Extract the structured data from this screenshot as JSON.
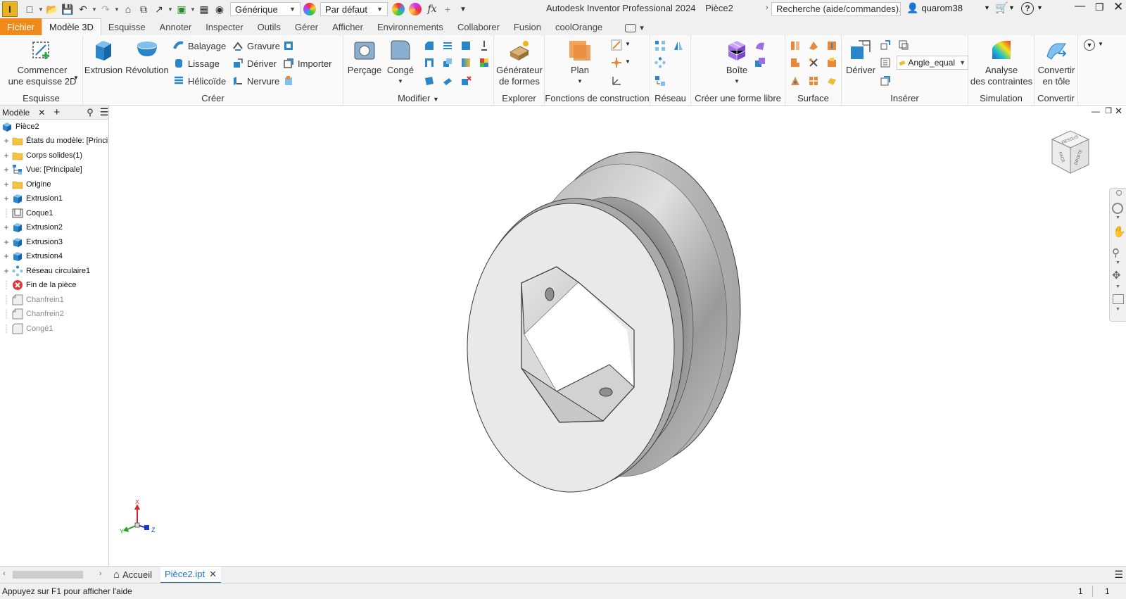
{
  "title_bar": {
    "material": "Générique",
    "appearance": "Par défaut",
    "app_title": "Autodesk Inventor Professional 2024",
    "document": "Pièce2",
    "search_placeholder": "Recherche (aide/commandes)...",
    "user": "quarom38"
  },
  "tabs": [
    {
      "label": "Fichier"
    },
    {
      "label": "Modèle 3D"
    },
    {
      "label": "Esquisse"
    },
    {
      "label": "Annoter"
    },
    {
      "label": "Inspecter"
    },
    {
      "label": "Outils"
    },
    {
      "label": "Gérer"
    },
    {
      "label": "Afficher"
    },
    {
      "label": "Environnements"
    },
    {
      "label": "Collaborer"
    },
    {
      "label": "Fusion"
    },
    {
      "label": "coolOrange"
    }
  ],
  "ribbon": {
    "esquisse": {
      "title": "Esquisse",
      "start_sketch_line1": "Commencer",
      "start_sketch_line2": "une esquisse 2D"
    },
    "creer": {
      "title": "Créer",
      "extrusion": "Extrusion",
      "revolution": "Révolution",
      "balayage": "Balayage",
      "lissage": "Lissage",
      "helicoide": "Hélicoïde",
      "gravure": "Gravure",
      "deriver": "Dériver",
      "nervure": "Nervure",
      "importer": "Importer"
    },
    "modifier": {
      "title": "Modifier",
      "percage": "Perçage",
      "conge": "Congé"
    },
    "explorer": {
      "title": "Explorer",
      "generator_line1": "Générateur",
      "generator_line2": "de formes"
    },
    "construction": {
      "title": "Fonctions de construction",
      "plan": "Plan"
    },
    "reseau": {
      "title": "Réseau"
    },
    "forme_libre": {
      "title": "Créer une forme libre",
      "boite": "Boîte"
    },
    "surface": {
      "title": "Surface"
    },
    "inserer": {
      "title": "Insérer",
      "deriver": "Dériver",
      "param": "Angle_equal"
    },
    "simulation": {
      "title": "Simulation",
      "analyse_line1": "Analyse",
      "analyse_line2": "des contraintes"
    },
    "convertir": {
      "title": "Convertir",
      "tole_line1": "Convertir",
      "tole_line2": "en tôle"
    }
  },
  "browser": {
    "tab": "Modèle",
    "root": "Pièce2",
    "items": [
      {
        "label": "États du modèle: [Princi",
        "icon": "folder-icon",
        "expandable": true,
        "dim": false
      },
      {
        "label": "Corps solides(1)",
        "icon": "folder-icon",
        "expandable": true,
        "dim": false
      },
      {
        "label": "Vue: [Principale]",
        "icon": "view-icon",
        "expandable": true,
        "dim": false
      },
      {
        "label": "Origine",
        "icon": "folder-icon",
        "expandable": true,
        "dim": false
      },
      {
        "label": "Extrusion1",
        "icon": "extrusion-icon",
        "expandable": true,
        "dim": false
      },
      {
        "label": "Coque1",
        "icon": "shell-icon",
        "expandable": false,
        "dim": false
      },
      {
        "label": "Extrusion2",
        "icon": "extrusion-icon",
        "expandable": true,
        "dim": false
      },
      {
        "label": "Extrusion3",
        "icon": "extrusion-icon",
        "expandable": true,
        "dim": false
      },
      {
        "label": "Extrusion4",
        "icon": "extrusion-icon",
        "expandable": true,
        "dim": false
      },
      {
        "label": "Réseau circulaire1",
        "icon": "pattern-icon",
        "expandable": true,
        "dim": false
      },
      {
        "label": "Fin de la pièce",
        "icon": "end-of-part-icon",
        "expandable": false,
        "dim": false
      },
      {
        "label": "Chanfrein1",
        "icon": "chamfer-icon",
        "expandable": false,
        "dim": true
      },
      {
        "label": "Chanfrein2",
        "icon": "chamfer-icon",
        "expandable": false,
        "dim": true
      },
      {
        "label": "Congé1",
        "icon": "fillet-icon",
        "expandable": false,
        "dim": true
      }
    ]
  },
  "viewcube": {
    "face_top": "DESSUS",
    "face_front": "FACE",
    "face_right": "DROITE"
  },
  "triad": {
    "x": "X",
    "y": "Y",
    "z": "Z"
  },
  "doc_tabs": {
    "home": "Accueil",
    "part": "Pièce2.ipt"
  },
  "status": {
    "help": "Appuyez sur F1 pour afficher l'aide",
    "count1": "1",
    "count2": "1"
  },
  "colors": {
    "file_tab": "#f08a1a",
    "accent_blue": "#1a73c8",
    "part_gray": "#c8c8c8"
  }
}
